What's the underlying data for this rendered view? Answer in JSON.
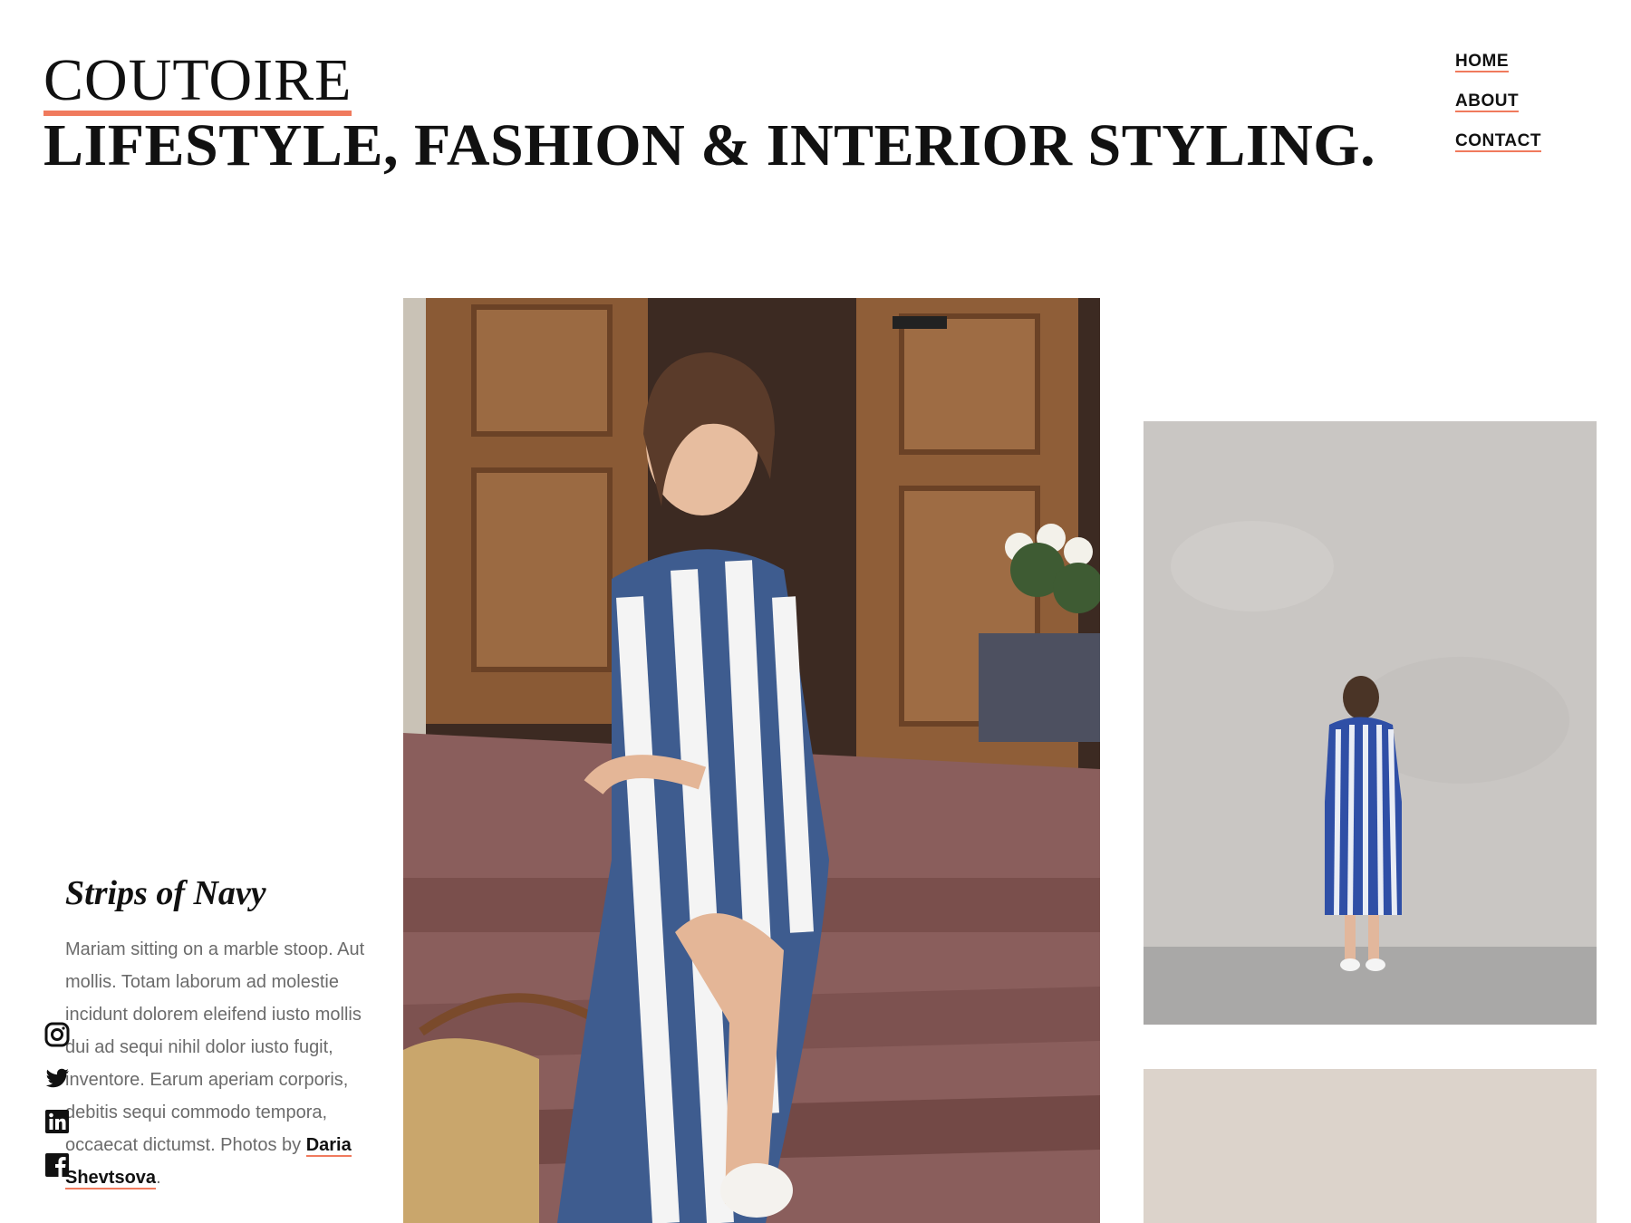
{
  "brand": {
    "name": "COUTOIRE",
    "tagline": "LIFESTYLE, FASHION & INTERIOR STYLING."
  },
  "nav": {
    "items": [
      {
        "label": "HOME"
      },
      {
        "label": "ABOUT"
      },
      {
        "label": "CONTACT"
      }
    ]
  },
  "caption": {
    "title": "Strips of Navy",
    "body": "Mariam sitting on a marble stoop. Aut mollis. Totam laborum ad molestie incidunt dolorem eleifend iusto mollis dui ad sequi nihil dolor iusto fugit, inventore. Earum aperiam corporis, debitis sequi commodo tempora, occaecat dictumst. Photos by ",
    "credit_link": "Daria Shevtsova",
    "credit_suffix": "."
  },
  "social": {
    "icons": [
      "instagram-icon",
      "twitter-icon",
      "linkedin-icon",
      "facebook-icon"
    ]
  },
  "colors": {
    "accent": "#f07a5d",
    "beige_block": "#dcd3cb",
    "text": "#111111",
    "muted_text": "#6b6b6b"
  }
}
